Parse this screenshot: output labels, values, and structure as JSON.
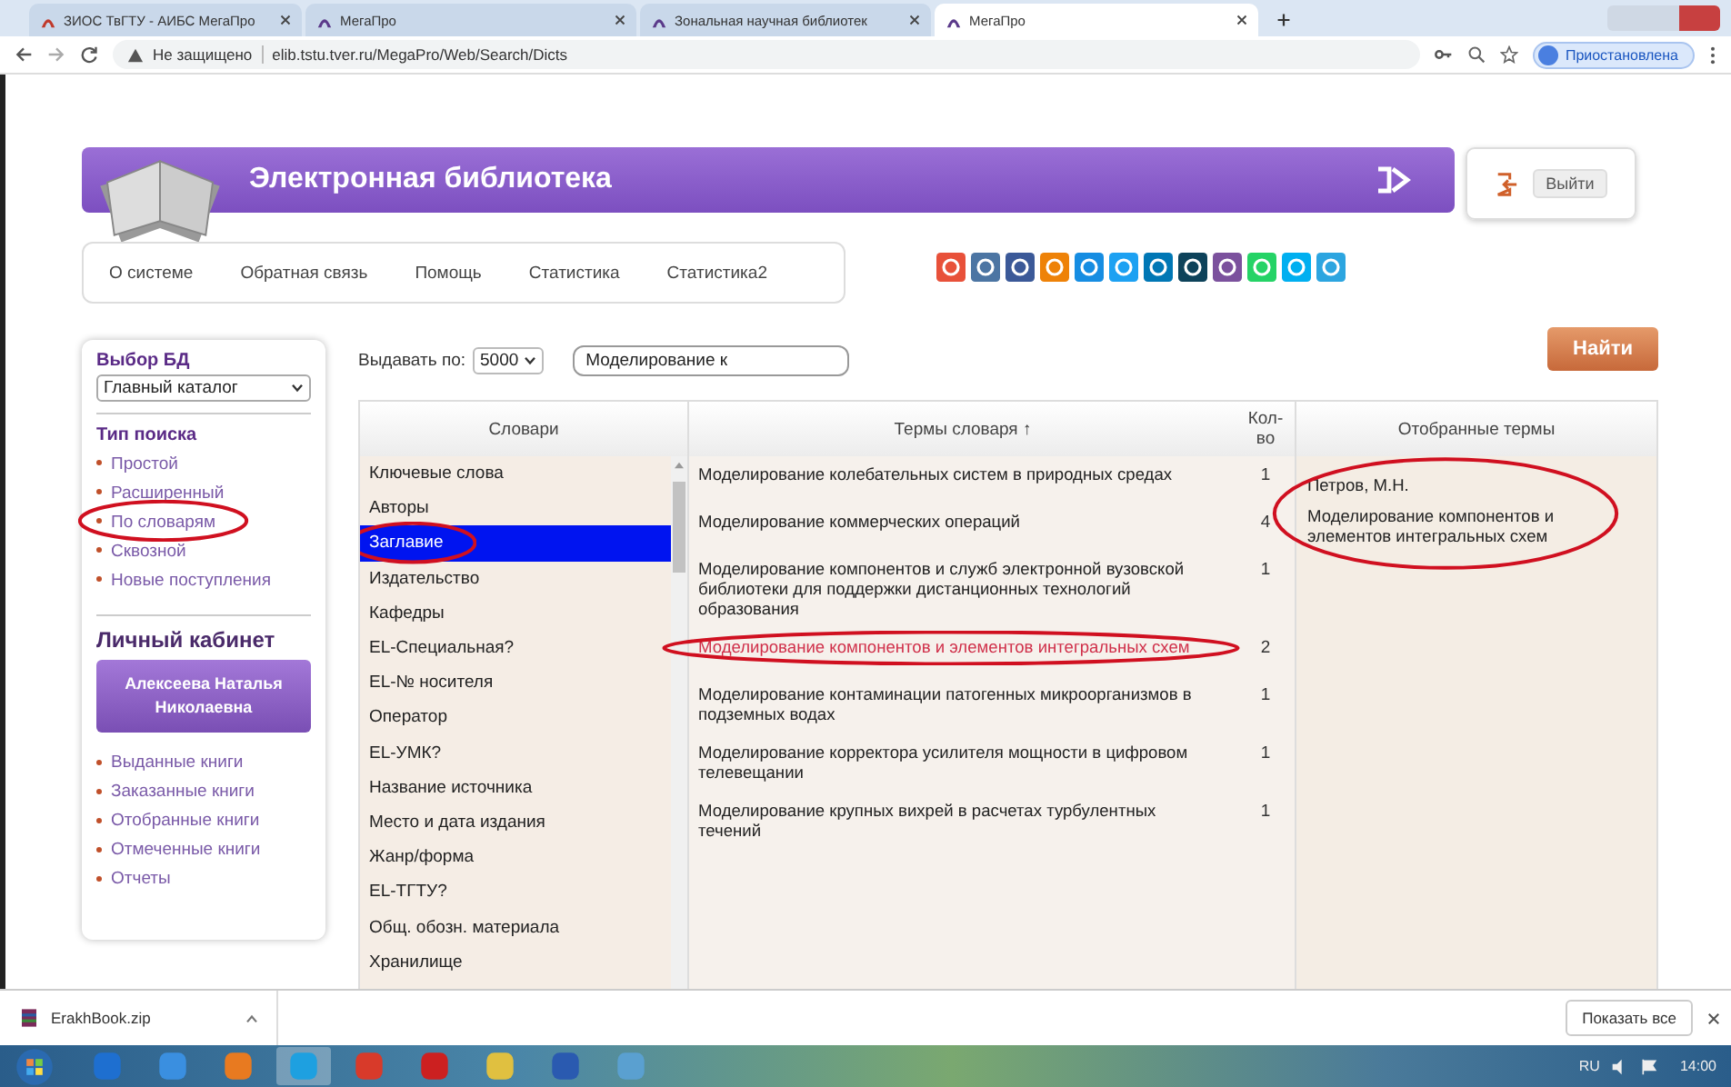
{
  "browser": {
    "tabs": [
      {
        "title": "ЗИОС ТвГТУ - АИБС МегаПро",
        "selected": false
      },
      {
        "title": "МегаПро",
        "selected": false
      },
      {
        "title": "Зональная научная библиотек",
        "selected": false
      },
      {
        "title": "МегаПро",
        "selected": true
      }
    ],
    "security": "Не защищено",
    "url": "elib.tstu.tver.ru/MegaPro/Web/Search/Dicts",
    "profile": "Приостановлена"
  },
  "header": {
    "title": "Электронная библиотека",
    "logout": "Выйти"
  },
  "nav": [
    "О системе",
    "Обратная связь",
    "Помощь",
    "Статистика",
    "Статистика2"
  ],
  "social": [
    {
      "color": "#e8513a"
    },
    {
      "color": "#4c75a3"
    },
    {
      "color": "#3b5998"
    },
    {
      "color": "#ee8208"
    },
    {
      "color": "#168de2"
    },
    {
      "color": "#1da1f2"
    },
    {
      "color": "#0077b5"
    },
    {
      "color": "#0d425a"
    },
    {
      "color": "#7b519d"
    },
    {
      "color": "#25d366"
    },
    {
      "color": "#00aff0"
    },
    {
      "color": "#2ca5e0"
    }
  ],
  "sidebar": {
    "db_label": "Выбор БД",
    "db_value": "Главный каталог",
    "search_type_title": "Тип поиска",
    "search_types": [
      {
        "label": "Простой",
        "circled": false
      },
      {
        "label": "Расширенный",
        "circled": false
      },
      {
        "label": "По словарям",
        "circled": true
      },
      {
        "label": "Сквозной",
        "circled": false
      },
      {
        "label": "Новые поступления",
        "circled": false
      }
    ],
    "cabinet_title": "Личный кабинет",
    "user": "Алексеева Наталья Николаевна",
    "cabinet_links": [
      "Выданные книги",
      "Заказанные книги",
      "Отобранные книги",
      "Отмеченные книги",
      "Отчеты"
    ]
  },
  "search": {
    "per_page_label": "Выдавать по:",
    "per_page": "5000",
    "query": "Моделирование к",
    "submit": "Найти"
  },
  "table": {
    "columns": [
      "Словари",
      "Термы словаря ↑",
      "Кол-во",
      "Отобранные термы"
    ],
    "dictionaries": [
      {
        "label": "Ключевые слова",
        "selected": false,
        "circled": false
      },
      {
        "label": "Авторы",
        "selected": false,
        "circled": false
      },
      {
        "label": "Заглавие",
        "selected": true,
        "circled": true
      },
      {
        "label": "Издательство",
        "selected": false,
        "circled": false
      },
      {
        "label": "Кафедры",
        "selected": false,
        "circled": false
      },
      {
        "label": "EL-Специальная?",
        "selected": false,
        "circled": false
      },
      {
        "label": "EL-№ носителя",
        "selected": false,
        "circled": false
      },
      {
        "label": "Оператор",
        "selected": false,
        "circled": false
      },
      {
        "label": "EL-УМК?",
        "selected": false,
        "circled": false
      },
      {
        "label": "Название источника",
        "selected": false,
        "circled": false
      },
      {
        "label": "Место и дата издания",
        "selected": false,
        "circled": false
      },
      {
        "label": "Жанр/форма",
        "selected": false,
        "circled": false
      },
      {
        "label": "EL-ТГТУ?",
        "selected": false,
        "circled": false
      },
      {
        "label": "Общ. обозн. материала",
        "selected": false,
        "circled": false
      },
      {
        "label": "Хранилище",
        "selected": false,
        "circled": false
      }
    ],
    "terms": [
      {
        "text": "Моделирование колебательных систем в природных средах",
        "count": "1",
        "selected": false,
        "circled": false
      },
      {
        "text": "Моделирование коммерческих операций",
        "count": "4",
        "selected": false,
        "circled": false
      },
      {
        "text": "Моделирование компонентов и служб электронной вузовской библиотеки для поддержки дистанционных технологий образования",
        "count": "1",
        "selected": false,
        "circled": false
      },
      {
        "text": "Моделирование компонентов и элементов интегральных схем",
        "count": "2",
        "selected": true,
        "circled": true
      },
      {
        "text": "Моделирование контаминации патогенных микроорганизмов в подземных водах",
        "count": "1",
        "selected": false,
        "circled": false
      },
      {
        "text": "Моделирование корректора усилителя мощности в цифровом телевещании",
        "count": "1",
        "selected": false,
        "circled": false
      },
      {
        "text": "Моделирование крупных вихрей в расчетах турбулентных течений",
        "count": "1",
        "selected": false,
        "circled": false
      }
    ],
    "selected_terms": [
      "Петров, М.Н.",
      "Моделирование компонентов и элементов интегральных схем"
    ],
    "selected_terms_circled": true
  },
  "downloads": {
    "file": "ErakhBook.zip",
    "show_all": "Показать все"
  },
  "taskbar": {
    "lang": "RU",
    "time": "14:00"
  }
}
